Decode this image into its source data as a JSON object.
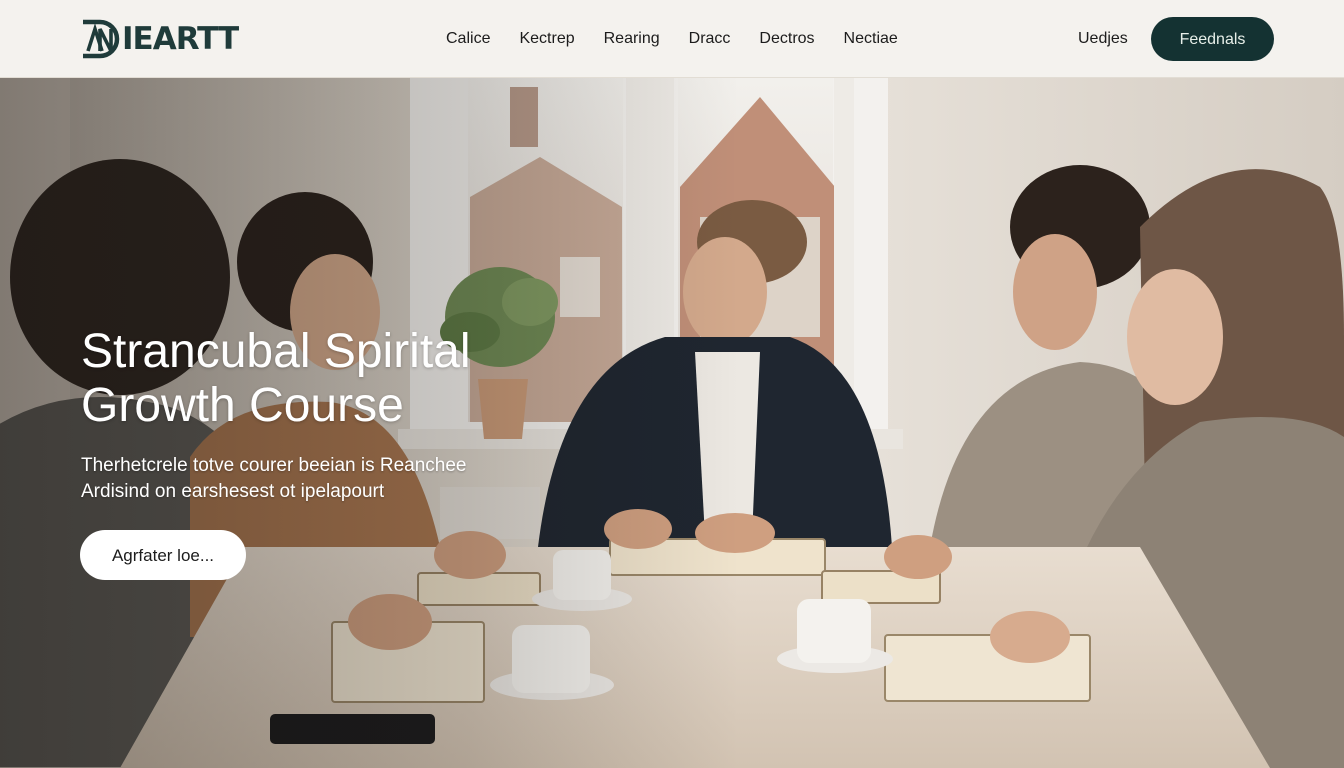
{
  "brand": {
    "name": "IEARTT",
    "logo_icon": "an-monogram-logo-icon",
    "color": "#1f3b3a"
  },
  "nav": {
    "items": [
      "Calice",
      "Kectrep",
      "Rearing",
      "Dracc",
      "Dectros",
      "Nectiae"
    ],
    "right_link": "Uedjes",
    "cta": "Feednals"
  },
  "hero": {
    "title_line1": "Strancubal Spirital",
    "title_line2": "Growth Course",
    "desc_line1": "Therhetcrele totve courer beeian is Reanchee",
    "desc_line2": "Ardisind on earshesest ot ipelapourt",
    "cta": "Agrfater loe..."
  },
  "colors": {
    "accent": "#143232",
    "header_bg": "#f4f2ee",
    "cta_text": "#e7efe9"
  }
}
